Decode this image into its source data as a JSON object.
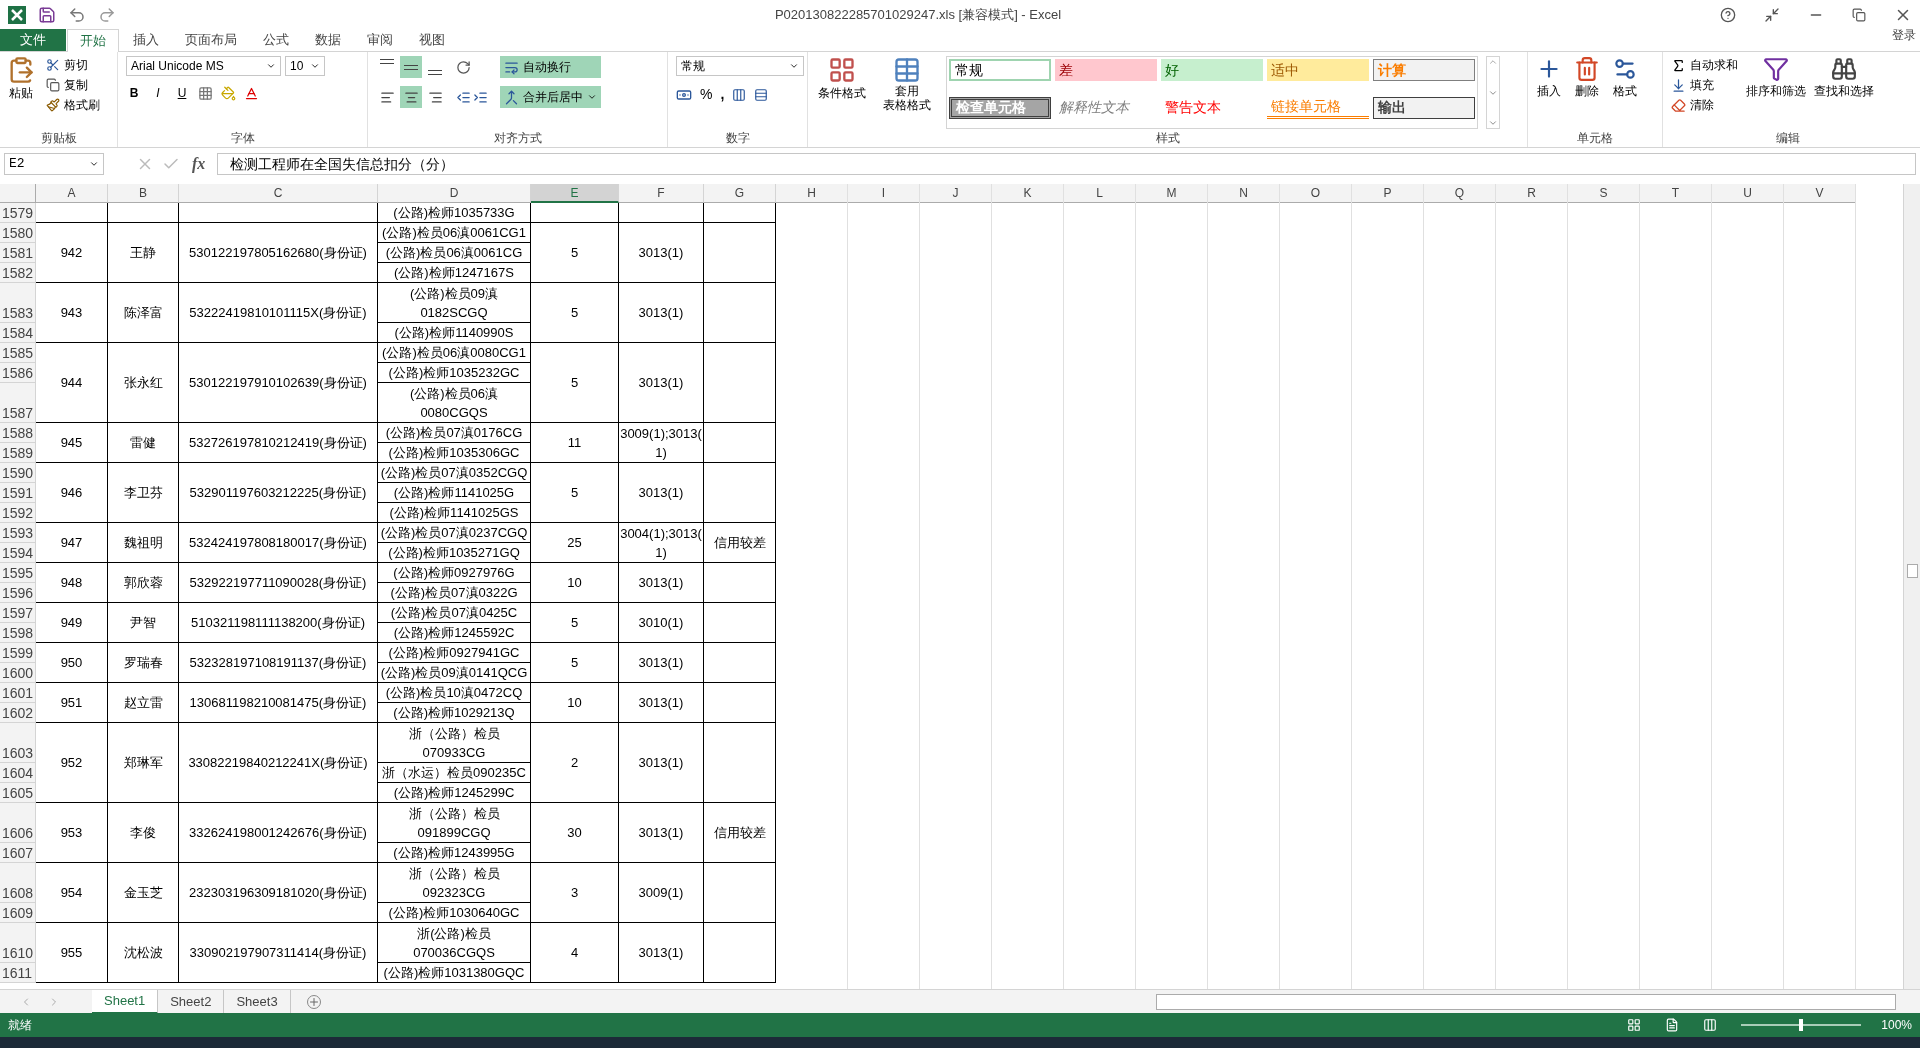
{
  "window": {
    "title": "P020130822285701029247.xls  [兼容模式] - Excel",
    "sign_in": "登录"
  },
  "tabs": [
    {
      "label": "文件",
      "kind": "file",
      "selected": false
    },
    {
      "label": "开始",
      "kind": "tab",
      "selected": true
    },
    {
      "label": "插入",
      "kind": "tab",
      "selected": false
    },
    {
      "label": "页面布局",
      "kind": "tab",
      "selected": false
    },
    {
      "label": "公式",
      "kind": "tab",
      "selected": false
    },
    {
      "label": "数据",
      "kind": "tab",
      "selected": false
    },
    {
      "label": "审阅",
      "kind": "tab",
      "selected": false
    },
    {
      "label": "视图",
      "kind": "tab",
      "selected": false
    }
  ],
  "ribbon": {
    "clipboard": {
      "label": "剪贴板",
      "paste": "粘贴",
      "cut": "剪切",
      "copy": "复制",
      "format_painter": "格式刷"
    },
    "font": {
      "label": "字体",
      "font_name": "Arial Unicode MS",
      "font_size": "10",
      "bold": "B",
      "italic": "I",
      "underline": "U"
    },
    "alignment": {
      "label": "对齐方式",
      "vertical": [
        {
          "selected": false
        },
        {
          "selected": true
        },
        {
          "selected": false
        }
      ],
      "horizontal": [
        {
          "selected": false
        },
        {
          "selected": true
        },
        {
          "selected": false
        }
      ],
      "wrap_text": {
        "text": "自动换行",
        "on": true
      },
      "merge_center": {
        "text": "合并后居中",
        "on": true
      }
    },
    "number": {
      "label": "数字",
      "format": "常规",
      "percent": "%",
      "comma": ","
    },
    "styles": {
      "label": "样式",
      "conditional": "条件格式",
      "table_format": [
        "套用",
        "表格格式"
      ],
      "cell_styles": [
        {
          "text": "常规",
          "kind": "normal"
        },
        {
          "text": "差",
          "kind": "bad"
        },
        {
          "text": "好",
          "kind": "good"
        },
        {
          "text": "适中",
          "kind": "neutral"
        },
        {
          "text": "计算",
          "kind": "calculation"
        },
        {
          "text": "检查单元格",
          "kind": "check"
        },
        {
          "text": "解释性文本",
          "kind": "explanatory"
        },
        {
          "text": "警告文本",
          "kind": "warning"
        },
        {
          "text": "链接单元格",
          "kind": "linked"
        },
        {
          "text": "输出",
          "kind": "output"
        }
      ]
    },
    "cells": {
      "label": "单元格",
      "insert": "插入",
      "delete": "删除",
      "format": "格式"
    },
    "editing": {
      "label": "编辑",
      "autosum": "自动求和",
      "fill": "填充",
      "clear": "清除",
      "sort_filter": "排序和筛选",
      "find_select": "查找和选择"
    }
  },
  "formula_bar": {
    "name_box": "E2",
    "function_label": "fx",
    "formula": "检测工程师在全国失信总扣分（分）"
  },
  "columns": [
    {
      "label": "A",
      "selected": false
    },
    {
      "label": "B",
      "selected": false
    },
    {
      "label": "C",
      "selected": false
    },
    {
      "label": "D",
      "selected": false
    },
    {
      "label": "E",
      "selected": true
    },
    {
      "label": "F",
      "selected": false
    },
    {
      "label": "G",
      "selected": false
    },
    {
      "label": "H",
      "selected": false
    },
    {
      "label": "I",
      "selected": false
    },
    {
      "label": "J",
      "selected": false
    },
    {
      "label": "K",
      "selected": false
    },
    {
      "label": "L",
      "selected": false
    },
    {
      "label": "M",
      "selected": false
    },
    {
      "label": "N",
      "selected": false
    },
    {
      "label": "O",
      "selected": false
    },
    {
      "label": "P",
      "selected": false
    },
    {
      "label": "Q",
      "selected": false
    },
    {
      "label": "R",
      "selected": false
    },
    {
      "label": "S",
      "selected": false
    },
    {
      "label": "T",
      "selected": false
    },
    {
      "label": "U",
      "selected": false
    },
    {
      "label": "V",
      "selected": false
    }
  ],
  "records": [
    {
      "rows": [
        {
          "num": "1579",
          "d": [
            "(公路)检师1035733G"
          ]
        }
      ]
    },
    {
      "a": "942",
      "b": "王静",
      "c": "530122197805162680(身份证)",
      "e": "5",
      "f": [
        "3013(1)"
      ],
      "rows": [
        {
          "num": "1580",
          "d": [
            "(公路)检员06滇0061CG1"
          ]
        },
        {
          "num": "1581",
          "d": [
            "(公路)检员06滇0061CG"
          ]
        },
        {
          "num": "1582",
          "d": [
            "(公路)检师1247167S"
          ]
        }
      ]
    },
    {
      "a": "943",
      "b": "陈泽富",
      "c": "53222419810101115X(身份证)",
      "e": "5",
      "f": [
        "3013(1)"
      ],
      "rows": [
        {
          "num": "1583",
          "d": [
            "(公路)检员09滇",
            "0182SCGQ"
          ]
        },
        {
          "num": "1584",
          "d": [
            "(公路)检师1140990S"
          ]
        }
      ]
    },
    {
      "a": "944",
      "b": "张永红",
      "c": "530122197910102639(身份证)",
      "e": "5",
      "f": [
        "3013(1)"
      ],
      "rows": [
        {
          "num": "1585",
          "d": [
            "(公路)检员06滇0080CG1"
          ]
        },
        {
          "num": "1586",
          "d": [
            "(公路)检师1035232GC"
          ]
        },
        {
          "num": "1587",
          "d": [
            "(公路)检员06滇",
            "0080CGQS"
          ]
        }
      ]
    },
    {
      "a": "945",
      "b": "雷健",
      "c": "532726197810212419(身份证)",
      "e": "11",
      "f": [
        "3009(1);3013(",
        "1)"
      ],
      "rows": [
        {
          "num": "1588",
          "d": [
            "(公路)检员07滇0176CG"
          ]
        },
        {
          "num": "1589",
          "d": [
            "(公路)检师1035306GC"
          ]
        }
      ]
    },
    {
      "a": "946",
      "b": "李卫芬",
      "c": "532901197603212225(身份证)",
      "e": "5",
      "f": [
        "3013(1)"
      ],
      "rows": [
        {
          "num": "1590",
          "d": [
            "(公路)检员07滇0352CGQ"
          ]
        },
        {
          "num": "1591",
          "d": [
            "(公路)检师1141025G"
          ]
        },
        {
          "num": "1592",
          "d": [
            "(公路)检师1141025GS"
          ]
        }
      ]
    },
    {
      "a": "947",
      "b": "魏祖明",
      "c": "532424197808180017(身份证)",
      "e": "25",
      "f": [
        "3004(1);3013(",
        "1)"
      ],
      "g": "信用较差",
      "rows": [
        {
          "num": "1593",
          "d": [
            "(公路)检员07滇0237CGQ"
          ]
        },
        {
          "num": "1594",
          "d": [
            "(公路)检师1035271GQ"
          ]
        }
      ]
    },
    {
      "a": "948",
      "b": "郭欣蓉",
      "c": "532922197711090028(身份证)",
      "e": "10",
      "f": [
        "3013(1)"
      ],
      "rows": [
        {
          "num": "1595",
          "d": [
            "(公路)检师0927976G"
          ]
        },
        {
          "num": "1596",
          "d": [
            "(公路)检员07滇0322G"
          ]
        }
      ]
    },
    {
      "a": "949",
      "b": "尹智",
      "c": "510321198111138200(身份证)",
      "e": "5",
      "f": [
        "3010(1)"
      ],
      "rows": [
        {
          "num": "1597",
          "d": [
            "(公路)检员07滇0425C"
          ]
        },
        {
          "num": "1598",
          "d": [
            "(公路)检师1245592C"
          ]
        }
      ]
    },
    {
      "a": "950",
      "b": "罗瑞春",
      "c": "532328197108191137(身份证)",
      "e": "5",
      "f": [
        "3013(1)"
      ],
      "rows": [
        {
          "num": "1599",
          "d": [
            "(公路)检师0927941GC"
          ]
        },
        {
          "num": "1600",
          "d": [
            "(公路)检员09滇0141QCG"
          ]
        }
      ]
    },
    {
      "a": "951",
      "b": "赵立雷",
      "c": "130681198210081475(身份证)",
      "e": "10",
      "f": [
        "3013(1)"
      ],
      "rows": [
        {
          "num": "1601",
          "d": [
            "(公路)检员10滇0472CQ"
          ]
        },
        {
          "num": "1602",
          "d": [
            "(公路)检师1029213Q"
          ]
        }
      ]
    },
    {
      "a": "952",
      "b": "郑琳军",
      "c": "33082219840212241X(身份证)",
      "e": "2",
      "f": [
        "3013(1)"
      ],
      "rows": [
        {
          "num": "1603",
          "d": [
            "浙（公路）检员",
            "070933CG"
          ]
        },
        {
          "num": "1604",
          "d": [
            "浙（水运）检员090235C"
          ]
        },
        {
          "num": "1605",
          "d": [
            "(公路)检师1245299C"
          ]
        }
      ]
    },
    {
      "a": "953",
      "b": "李俊",
      "c": "332624198001242676(身份证)",
      "e": "30",
      "f": [
        "3013(1)"
      ],
      "g": "信用较差",
      "rows": [
        {
          "num": "1606",
          "d": [
            "浙（公路）检员",
            "091899CGQ"
          ]
        },
        {
          "num": "1607",
          "d": [
            "(公路)检师1243995G"
          ]
        }
      ]
    },
    {
      "a": "954",
      "b": "金玉芝",
      "c": "232303196309181020(身份证)",
      "e": "3",
      "f": [
        "3009(1)"
      ],
      "rows": [
        {
          "num": "1608",
          "d": [
            "浙（公路）检员",
            "092323CG"
          ]
        },
        {
          "num": "1609",
          "d": [
            "(公路)检师1030640GC"
          ]
        }
      ]
    },
    {
      "a": "955",
      "b": "沈松波",
      "c": "330902197907311414(身份证)",
      "e": "4",
      "f": [
        "3013(1)"
      ],
      "rows": [
        {
          "num": "1610",
          "d": [
            "浙(公路)检员",
            "070036CGQS"
          ]
        },
        {
          "num": "1611",
          "d": [
            "(公路)检师1031380GQC"
          ]
        }
      ]
    }
  ],
  "sheets": [
    {
      "label": "Sheet1",
      "selected": true
    },
    {
      "label": "Sheet2",
      "selected": false
    },
    {
      "label": "Sheet3",
      "selected": false
    }
  ],
  "status_bar": {
    "status": "就绪",
    "zoom_slider": {
      "level": 0.5
    },
    "zoom": "100%"
  }
}
